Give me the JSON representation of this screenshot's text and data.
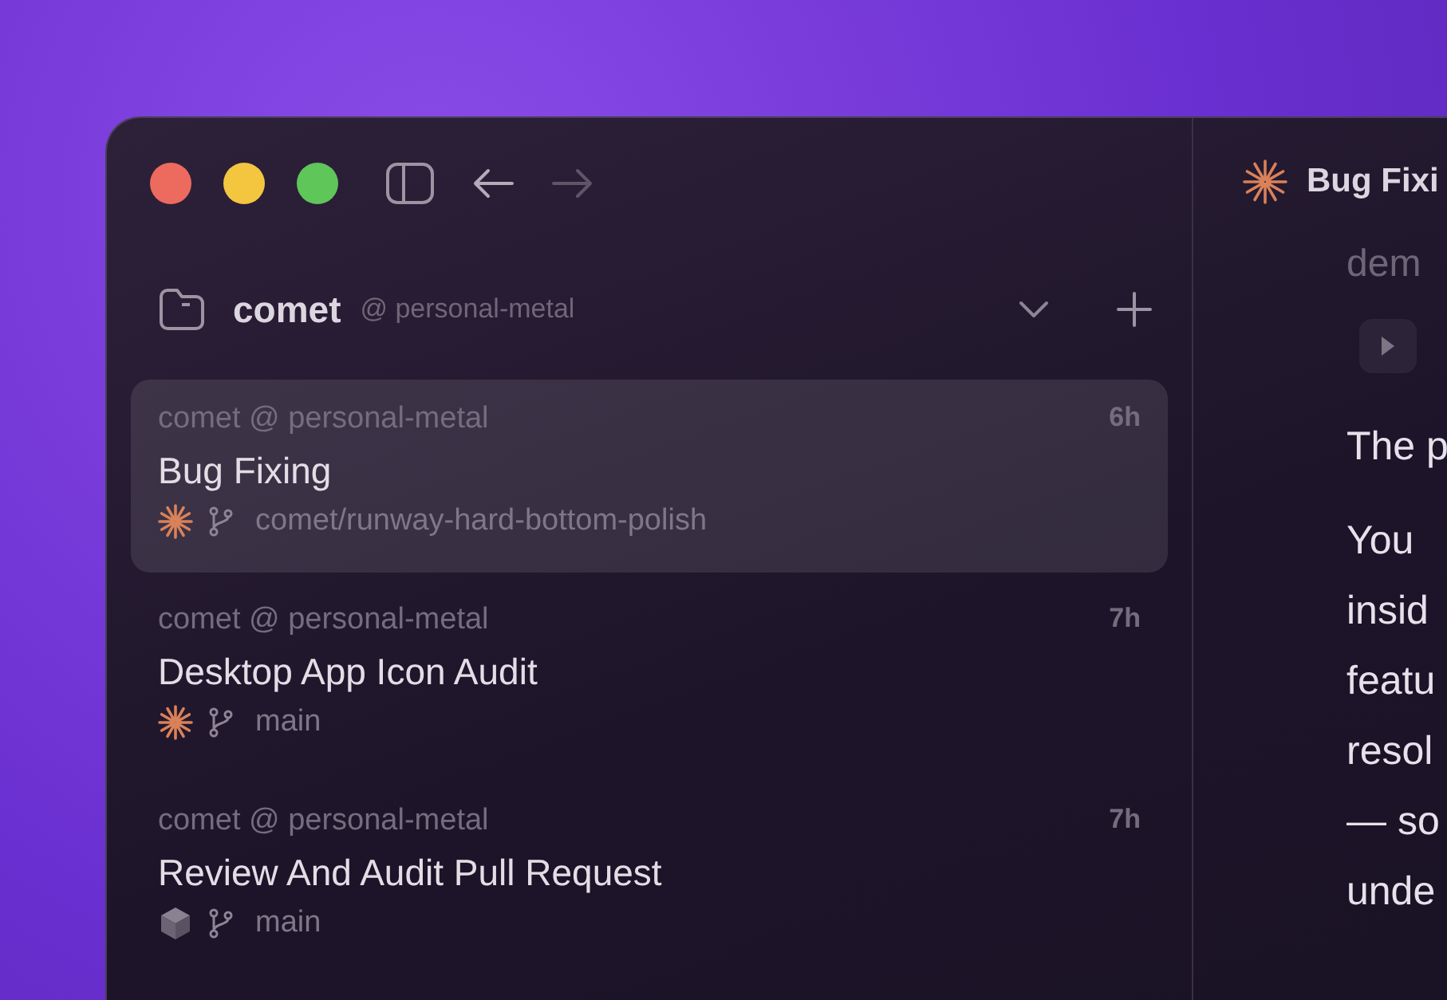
{
  "toolbar": {
    "back_disabled": false,
    "forward_disabled": true
  },
  "sidebar": {
    "project": {
      "name": "comet",
      "workspace": "@ personal-metal"
    },
    "threads": [
      {
        "location": "comet @ personal-metal",
        "time": "6h",
        "title": "Bug Fixing",
        "kind": "spark",
        "branch": "comet/runway-hard-bottom-polish",
        "selected": true
      },
      {
        "location": "comet @ personal-metal",
        "time": "7h",
        "title": "Desktop App Icon Audit",
        "kind": "spark",
        "branch": "main",
        "selected": false
      },
      {
        "location": "comet @ personal-metal",
        "time": "7h",
        "title": "Review And Audit Pull Request",
        "kind": "cube",
        "branch": "main",
        "selected": false
      }
    ]
  },
  "main": {
    "title": "Bug Fixi",
    "subtitle": "dem",
    "lead": "The p",
    "lines": [
      "You",
      "insid",
      "featu",
      "resol",
      "— so",
      "unde"
    ]
  }
}
